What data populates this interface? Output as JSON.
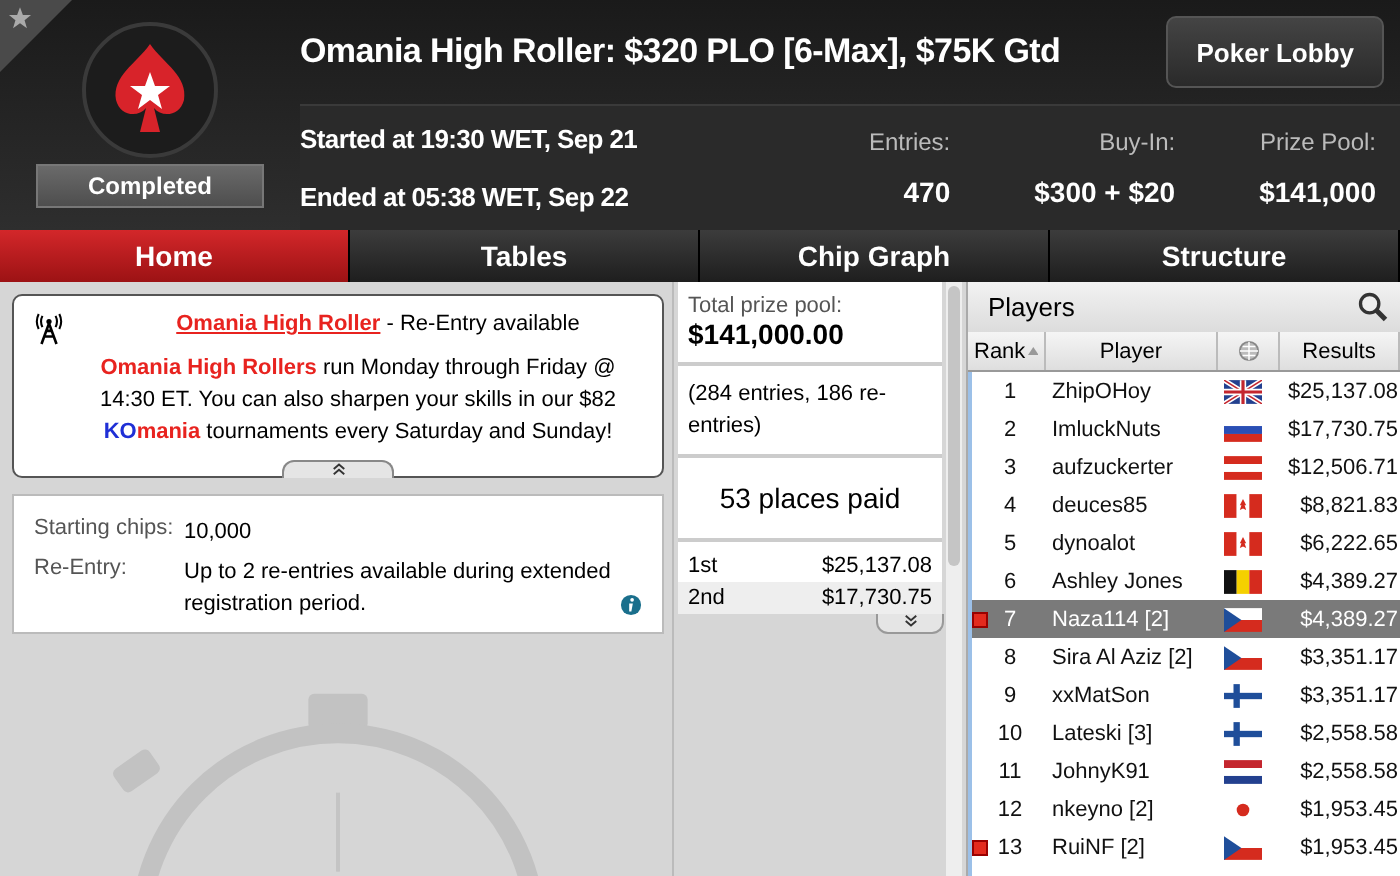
{
  "window": {
    "title": "Omania High Roller: $320 PLO [6-Max], $75K Gtd"
  },
  "status": "Completed",
  "times": [
    "Started at 19:30 WET, Sep 21",
    "Ended at 05:38 WET, Sep 22"
  ],
  "lobby_button": "Poker Lobby",
  "stats": [
    {
      "label": "Entries:",
      "value": "470"
    },
    {
      "label": "Buy-In:",
      "value": "$300 + $20"
    },
    {
      "label": "Prize Pool:",
      "value": "$141,000"
    }
  ],
  "tabs": [
    {
      "label": "Home",
      "selected": true
    },
    {
      "label": "Tables",
      "selected": false
    },
    {
      "label": "Chip Graph",
      "selected": false
    },
    {
      "label": "Structure",
      "selected": false
    }
  ],
  "news": {
    "link": "Omania High Roller",
    "headline": " - Re-Entry available",
    "body": [
      {
        "kind": "highlight",
        "text": "Omania High Rollers"
      },
      {
        "kind": "plain",
        "text": " run Monday through Friday @ 14:30 ET. You can also sharpen your skills in our $82 "
      },
      {
        "kind": "brand-ko",
        "text": "KO"
      },
      {
        "kind": "highlight",
        "text": "mania"
      },
      {
        "kind": "plain",
        "text": " tournaments every Saturday and Sunday!"
      }
    ]
  },
  "details": [
    {
      "label": "Starting chips:",
      "value": "10,000",
      "info": false
    },
    {
      "label": "Re-Entry:",
      "value": "Up to 2 re-entries available during extended registration period.",
      "info": true
    }
  ],
  "prize": {
    "label": "Total prize pool:",
    "total": "$141,000.00",
    "note": "(284 entries, 186 re-entries)",
    "places": "53 places paid",
    "payouts": [
      {
        "place": "1st",
        "amount": "$25,137.08"
      },
      {
        "place": "2nd",
        "amount": "$17,730.75"
      }
    ]
  },
  "players": {
    "title": "Players",
    "columns": [
      "Rank",
      "Player",
      "Results"
    ],
    "rows": [
      {
        "rank": "1",
        "name": "ZhipOHoy",
        "kind": "gb",
        "result": "$25,137.08",
        "marked": false,
        "selected": false
      },
      {
        "rank": "2",
        "name": "ImluckNuts",
        "kind": "ru",
        "result": "$17,730.75",
        "marked": false,
        "selected": false
      },
      {
        "rank": "3",
        "name": "aufzuckerter",
        "kind": "at",
        "result": "$12,506.71",
        "marked": false,
        "selected": false
      },
      {
        "rank": "4",
        "name": "deuces85",
        "kind": "ca",
        "result": "$8,821.83",
        "marked": false,
        "selected": false
      },
      {
        "rank": "5",
        "name": "dynoalot",
        "kind": "ca",
        "result": "$6,222.65",
        "marked": false,
        "selected": false
      },
      {
        "rank": "6",
        "name": "Ashley Jones",
        "kind": "be",
        "result": "$4,389.27",
        "marked": false,
        "selected": false
      },
      {
        "rank": "7",
        "name": "Naza114 [2]",
        "kind": "cz",
        "result": "$4,389.27",
        "marked": true,
        "selected": true
      },
      {
        "rank": "8",
        "name": "Sira Al Aziz [2]",
        "kind": "cz",
        "result": "$3,351.17",
        "marked": false,
        "selected": false
      },
      {
        "rank": "9",
        "name": "xxMatSon",
        "kind": "fi",
        "result": "$3,351.17",
        "marked": false,
        "selected": false
      },
      {
        "rank": "10",
        "name": "Lateski [3]",
        "kind": "fi",
        "result": "$2,558.58",
        "marked": false,
        "selected": false
      },
      {
        "rank": "11",
        "name": "JohnyK91",
        "kind": "nl",
        "result": "$2,558.58",
        "marked": false,
        "selected": false
      },
      {
        "rank": "12",
        "name": "nkeyno [2]",
        "kind": "jp",
        "result": "$1,953.45",
        "marked": false,
        "selected": false
      },
      {
        "rank": "13",
        "name": "RuiNF [2]",
        "kind": "cz",
        "result": "$1,953.45",
        "marked": true,
        "selected": false
      }
    ]
  }
}
